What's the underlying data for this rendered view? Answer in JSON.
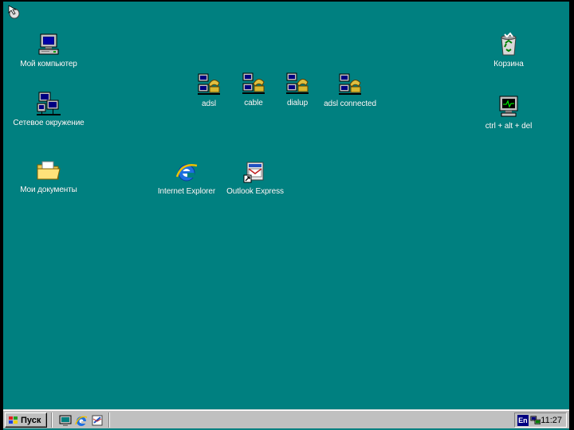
{
  "desktop": {
    "background_color": "#008080",
    "icons": {
      "my_computer": {
        "label": "Мой компьютер",
        "icon": "computer-icon"
      },
      "network": {
        "label": "Сетевое окружение",
        "icon": "network-icon"
      },
      "my_documents": {
        "label": "Мои документы",
        "icon": "folder-icon"
      },
      "adsl": {
        "label": "adsl",
        "icon": "dialup-connection-icon"
      },
      "cable": {
        "label": "cable",
        "icon": "dialup-connection-icon"
      },
      "dialup": {
        "label": "dialup",
        "icon": "dialup-connection-icon"
      },
      "adsl_connected": {
        "label": "adsl connected",
        "icon": "dialup-connection-icon"
      },
      "internet_explorer": {
        "label": "Internet Explorer",
        "icon": "internet-explorer-icon"
      },
      "outlook_express": {
        "label": "Outlook Express",
        "icon": "outlook-express-icon"
      },
      "recycle_bin": {
        "label": "Корзина",
        "icon": "recycle-bin-icon"
      },
      "ctrl_alt_del": {
        "label": "ctrl + alt + del",
        "icon": "monitor-icon"
      }
    }
  },
  "taskbar": {
    "start_label": "Пуск",
    "quick_launch": [
      "show-desktop-icon",
      "internet-explorer-icon",
      "outlook-express-icon"
    ],
    "language": "En",
    "clock": "11:27"
  }
}
